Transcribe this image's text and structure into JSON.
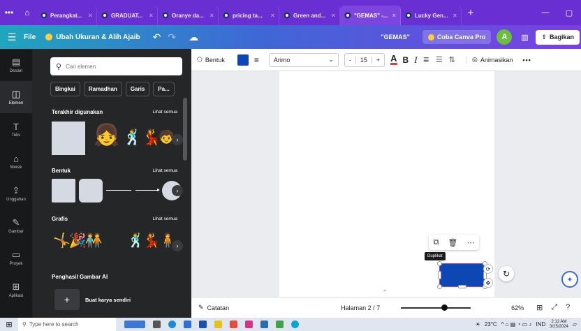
{
  "browser": {
    "controls": [
      "•••",
      "⌂"
    ],
    "tabs": [
      {
        "label": "Perangkat...",
        "active": false
      },
      {
        "label": "GRADUAT...",
        "active": false
      },
      {
        "label": "Oranye da...",
        "active": false
      },
      {
        "label": "pricing ta...",
        "active": false
      },
      {
        "label": "Green and...",
        "active": false
      },
      {
        "label": "\"GEMAS\" -...",
        "active": true
      },
      {
        "label": "Lucky Gen...",
        "active": false
      }
    ],
    "new_tab": "+",
    "window_controls": [
      "—",
      "▢"
    ]
  },
  "header": {
    "menu": "File",
    "resize": "Ubah Ukuran & Alih Ajaib",
    "doc_title": "\"GEMAS\"",
    "try_pro": "Coba Canva Pro",
    "avatar_letter": "A",
    "share": "Bagikan"
  },
  "rail": {
    "items": [
      {
        "label": "Desain",
        "icon": "▤"
      },
      {
        "label": "Elemen",
        "icon": "◫"
      },
      {
        "label": "Teks",
        "icon": "T"
      },
      {
        "label": "Merek",
        "icon": "⌂"
      },
      {
        "label": "Unggahan",
        "icon": "⇪"
      },
      {
        "label": "Gambar",
        "icon": "✎"
      },
      {
        "label": "Proyek",
        "icon": "▭"
      },
      {
        "label": "Aplikasi",
        "icon": "⊞"
      }
    ]
  },
  "panel": {
    "search_placeholder": "Cari elemen",
    "chips": [
      "Bingkai",
      "Ramadhan",
      "Garis",
      "Pa..."
    ],
    "recent_title": "Terakhir digunakan",
    "shapes_title": "Bentuk",
    "graphics_title": "Grafis",
    "see_all": "Lihat semua",
    "ai_title": "Penghasil Gambar AI",
    "ai_button": "Buat karya sendiri"
  },
  "toolbar": {
    "shape": "Bentuk",
    "font": "Arimo",
    "size": "15",
    "minus": "-",
    "plus": "+",
    "animate": "Animasikan",
    "more": "•••",
    "colors": {
      "fill": "#0d47b3"
    }
  },
  "canvas": {
    "tooltip": "Duplikat",
    "page_handle": "^"
  },
  "bottombar": {
    "notes": "Catatan",
    "page": "Halaman 2 / 7",
    "zoom": "62%",
    "zoom_fraction": 0.62
  },
  "taskbar": {
    "search_placeholder": "Type here to search",
    "weather": "23°C",
    "lang": "IND",
    "time": "2:12 AM",
    "date": "3/25/2024"
  }
}
